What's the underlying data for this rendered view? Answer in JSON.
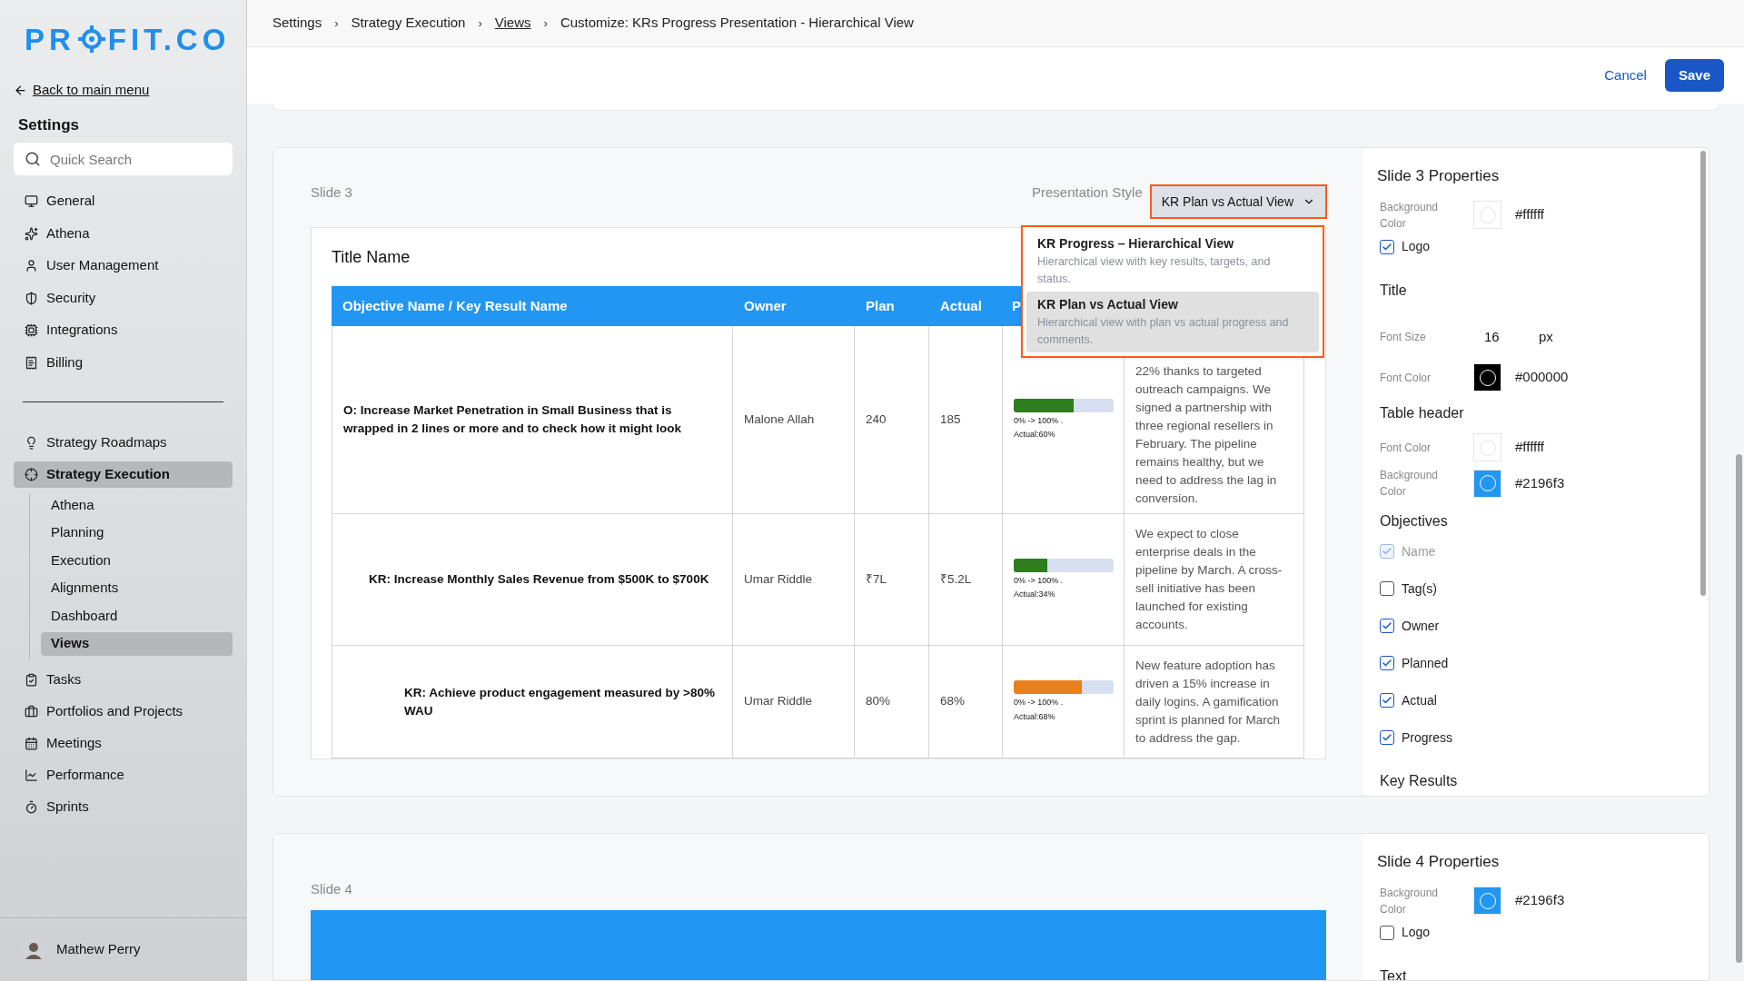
{
  "logo": {
    "before": "PR",
    "after": "FIT.CO"
  },
  "sidebar": {
    "back_link": "Back to main menu",
    "title": "Settings",
    "search": {
      "placeholder": "Quick Search"
    },
    "items": [
      {
        "label": "General",
        "selected": false
      },
      {
        "label": "Athena",
        "selected": false
      },
      {
        "label": "User Management",
        "selected": false
      },
      {
        "label": "Security",
        "selected": false
      },
      {
        "label": "Integrations",
        "selected": false
      },
      {
        "label": "Billing",
        "selected": false
      }
    ],
    "items2": [
      {
        "label": "Strategy Roadmaps",
        "selected": false
      },
      {
        "label": "Strategy Execution",
        "selected": true,
        "children": [
          {
            "label": "Athena",
            "selected": false
          },
          {
            "label": "Planning",
            "selected": false
          },
          {
            "label": "Execution",
            "selected": false
          },
          {
            "label": "Alignments",
            "selected": false
          },
          {
            "label": "Dashboard",
            "selected": false
          },
          {
            "label": "Views",
            "selected": true
          }
        ]
      },
      {
        "label": "Tasks",
        "selected": false
      },
      {
        "label": "Portfolios and Projects",
        "selected": false
      },
      {
        "label": "Meetings",
        "selected": false
      },
      {
        "label": "Performance",
        "selected": false
      },
      {
        "label": "Sprints",
        "selected": false
      }
    ],
    "user": {
      "name": "Mathew Perry"
    }
  },
  "breadcrumbs": [
    {
      "kind": "crumb",
      "text": "Settings",
      "link": false
    },
    {
      "kind": "separator",
      "text": "›"
    },
    {
      "kind": "crumb",
      "text": "Strategy Execution",
      "link": false
    },
    {
      "kind": "separator",
      "text": "›"
    },
    {
      "kind": "crumb",
      "text": "Views",
      "link": true
    },
    {
      "kind": "separator",
      "text": "›"
    },
    {
      "kind": "crumb",
      "text": "Customize: KRs Progress Presentation - Hierarchical View",
      "link": false
    }
  ],
  "actions": {
    "cancel": "Cancel",
    "save": "Save"
  },
  "slide3": {
    "label": "Slide 3",
    "style_label": "Presentation Style",
    "style_value": "KR Plan vs Actual View",
    "style_options": [
      {
        "title": "KR Progress – Hierarchical View",
        "description": "Hierarchical view with key results, targets, and status.",
        "selected": false
      },
      {
        "title": "KR Plan vs Actual View",
        "description": "Hierarchical view with plan vs actual progress and comments.",
        "selected": true
      }
    ],
    "title": "Title Name",
    "table": {
      "columns": [
        "Objective Name / Key Result Name",
        "Owner",
        "Plan",
        "Actual",
        "P"
      ],
      "rows": [
        {
          "name": "O: Increase Market Penetration in Small Business that is wrapped in 2 lines or more and to check how it might look",
          "owner": "Malone Allah",
          "plan": "240",
          "actual": "185",
          "progress": {
            "level": 0.6,
            "color": "#2e7d1f",
            "range": "0% -> 100% .",
            "reading": "Actual:60%"
          },
          "comment": "22% thanks to targeted outreach campaigns. We signed a partnership with three regional resellers in February. The pipeline remains healthy, but we need to address the lag in conversion.",
          "children": [
            {
              "name": "KR: Increase Monthly Sales Revenue from $500K to $700K",
              "owner": "Umar Riddle",
              "plan": "₹7L",
              "actual": "₹5.2L",
              "progress": {
                "level": 0.34,
                "color": "#2e7d1f",
                "range": "0% -> 100% .",
                "reading": "Actual:34%"
              },
              "comment": "We expect to close enterprise deals in the pipeline by March. A cross-sell initiative has been launched for existing accounts.",
              "children": [
                {
                  "name": "KR: Achieve product engagement measured by >80% WAU",
                  "owner": "Umar Riddle",
                  "plan": "80%",
                  "actual": "68%",
                  "progress": {
                    "level": 0.68,
                    "color": "#e8801e",
                    "range": "0% -> 100% .",
                    "reading": "Actual:68%"
                  },
                  "comment": "New feature adoption has driven a 15% increase in daily logins. A gamification sprint is planned for March to address the gap."
                }
              ]
            }
          ]
        }
      ]
    }
  },
  "slide3_properties": {
    "title": "Slide 3 Properties",
    "items": [
      {
        "kind": "color",
        "label": "Background Color",
        "color": "#ffffff",
        "value": "#ffffff"
      },
      {
        "kind": "checkbox",
        "label": "Logo",
        "checked": true,
        "disabled": false
      },
      {
        "kind": "heading",
        "label": "Title"
      },
      {
        "kind": "number",
        "label": "Font Size",
        "value": "16",
        "unit": "px"
      },
      {
        "kind": "color",
        "label": "Font Color",
        "color": "#000000",
        "value": "#000000"
      },
      {
        "kind": "heading",
        "label": "Table header"
      },
      {
        "kind": "color",
        "label": "Font Color",
        "color": "#ffffff",
        "value": "#ffffff"
      },
      {
        "kind": "color",
        "label": "Background Color",
        "color": "#2196f3",
        "value": "#2196f3"
      },
      {
        "kind": "heading",
        "label": "Objectives"
      },
      {
        "kind": "checkbox",
        "label": "Name",
        "checked": true,
        "disabled": true
      },
      {
        "kind": "checkbox",
        "label": "Tag(s)",
        "checked": false,
        "disabled": false
      },
      {
        "kind": "checkbox",
        "label": "Owner",
        "checked": true,
        "disabled": false
      },
      {
        "kind": "checkbox",
        "label": "Planned",
        "checked": true,
        "disabled": false
      },
      {
        "kind": "checkbox",
        "label": "Actual",
        "checked": true,
        "disabled": false
      },
      {
        "kind": "checkbox",
        "label": "Progress",
        "checked": true,
        "disabled": false
      },
      {
        "kind": "heading",
        "label": "Key Results"
      }
    ]
  },
  "slide4": {
    "label": "Slide 4"
  },
  "slide4_properties": {
    "title": "Slide 4 Properties",
    "items": [
      {
        "kind": "color",
        "label": "Background Color",
        "color": "#2196f3",
        "value": "#2196f3"
      },
      {
        "kind": "checkbox",
        "label": "Logo",
        "checked": false,
        "disabled": false
      },
      {
        "kind": "heading",
        "label": "Text"
      }
    ]
  }
}
